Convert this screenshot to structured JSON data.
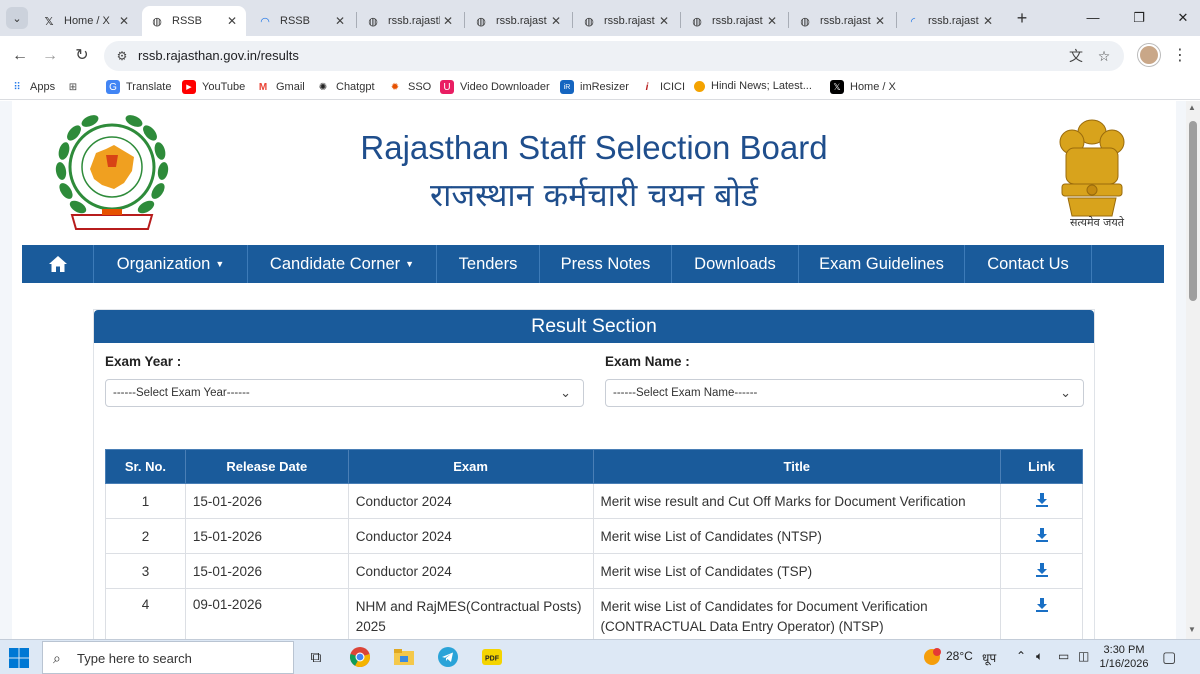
{
  "browser": {
    "tabs": [
      {
        "label": "Home / X",
        "icon": "x-icon"
      },
      {
        "label": "RSSB",
        "icon": "globe-icon",
        "active": true
      },
      {
        "label": "RSSB",
        "icon": "loading-icon"
      },
      {
        "label": "rssb.rajasth",
        "icon": "globe-icon"
      },
      {
        "label": "rssb.rajast",
        "icon": "globe-icon"
      },
      {
        "label": "rssb.rajast",
        "icon": "globe-icon"
      },
      {
        "label": "rssb.rajast",
        "icon": "globe-icon"
      },
      {
        "label": "rssb.rajast",
        "icon": "globe-icon"
      },
      {
        "label": "rssb.rajast",
        "icon": "loading-icon"
      }
    ],
    "url": "rssb.rajasthan.gov.in/results",
    "bookmarks": [
      {
        "label": "Apps",
        "icon": "apps-grid-icon",
        "color": "#1a73e8"
      },
      {
        "label": "",
        "icon": "tab-groups-icon",
        "color": "#444444"
      },
      {
        "label": "Translate",
        "icon": "translate-icon",
        "color": "#4285f4"
      },
      {
        "label": "YouTube",
        "icon": "youtube-icon",
        "color": "#ff0000"
      },
      {
        "label": "Gmail",
        "icon": "gmail-icon",
        "color": "#ea4335"
      },
      {
        "label": "Chatgpt",
        "icon": "chatgpt-icon",
        "color": "#222222"
      },
      {
        "label": "SSO",
        "icon": "sso-icon",
        "color": "#e65100"
      },
      {
        "label": "Video Downloader",
        "icon": "video-downloader-icon",
        "color": "#e91e63"
      },
      {
        "label": "imResizer",
        "icon": "imresizer-icon",
        "color": "#1565c0"
      },
      {
        "label": "ICICI",
        "icon": "icici-icon",
        "color": "#b71c1c"
      },
      {
        "label": "Hindi News; Latest...",
        "icon": "news-icon",
        "color": "#f4a300"
      },
      {
        "label": "Home / X",
        "icon": "x-icon",
        "color": "#000000"
      }
    ]
  },
  "site": {
    "title_en": "Rajasthan Staff Selection Board",
    "title_hi": "राजस्थान कर्मचारी चयन बोर्ड",
    "emblem_text": "सत्यमेव जयते",
    "nav": [
      {
        "label": "Organization",
        "dropdown": true
      },
      {
        "label": "Candidate Corner",
        "dropdown": true
      },
      {
        "label": "Tenders",
        "dropdown": false
      },
      {
        "label": "Press Notes",
        "dropdown": false
      },
      {
        "label": "Downloads",
        "dropdown": false
      },
      {
        "label": "Exam Guidelines",
        "dropdown": false
      },
      {
        "label": "Contact Us",
        "dropdown": false
      }
    ],
    "brand_color": "#1a5b9b"
  },
  "results": {
    "heading": "Result Section",
    "exam_year_label": "Exam Year :",
    "exam_year_value": "------Select Exam Year------",
    "exam_name_label": "Exam Name :",
    "exam_name_value": "------Select Exam Name------",
    "columns": [
      "Sr. No.",
      "Release Date",
      "Exam",
      "Title",
      "Link"
    ],
    "rows": [
      {
        "sr": "1",
        "date": "15-01-2026",
        "exam": "Conductor 2024",
        "title": "Merit wise result and Cut Off Marks for Document Verification"
      },
      {
        "sr": "2",
        "date": "15-01-2026",
        "exam": "Conductor 2024",
        "title": "Merit wise List of Candidates (NTSP)"
      },
      {
        "sr": "3",
        "date": "15-01-2026",
        "exam": "Conductor 2024",
        "title": "Merit wise List of Candidates (TSP)"
      },
      {
        "sr": "4",
        "date": "09-01-2026",
        "exam": "NHM and RajMES(Contractual Posts) 2025",
        "title": "Merit wise List of Candidates for Document Verification (CONTRACTUAL Data Entry Operator) (NTSP)"
      }
    ]
  },
  "taskbar": {
    "search_placeholder": "Type here to search",
    "weather": "28°C",
    "weather_desc": "धूप",
    "time": "3:30 PM",
    "date": "1/16/2026"
  }
}
